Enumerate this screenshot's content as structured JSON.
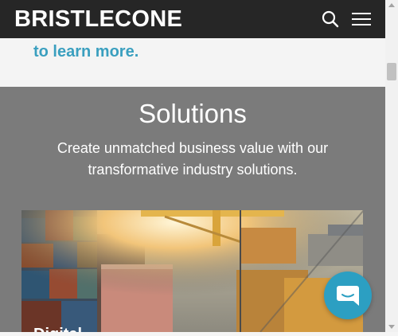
{
  "header": {
    "logo_text": "BRISTLECONE",
    "search_icon": "search-icon",
    "menu_icon": "hamburger-menu-icon",
    "background": "#262626"
  },
  "intro": {
    "link_text": "to learn more.",
    "link_color": "#3a9fbf"
  },
  "solutions": {
    "title": "Solutions",
    "description": "Create unmatched business value with our transformative industry solutions.",
    "background": "#7b7b7b",
    "card": {
      "title": "Digital"
    }
  },
  "chat": {
    "icon": "chat-bubble-icon",
    "color": "#2c9fc2"
  }
}
